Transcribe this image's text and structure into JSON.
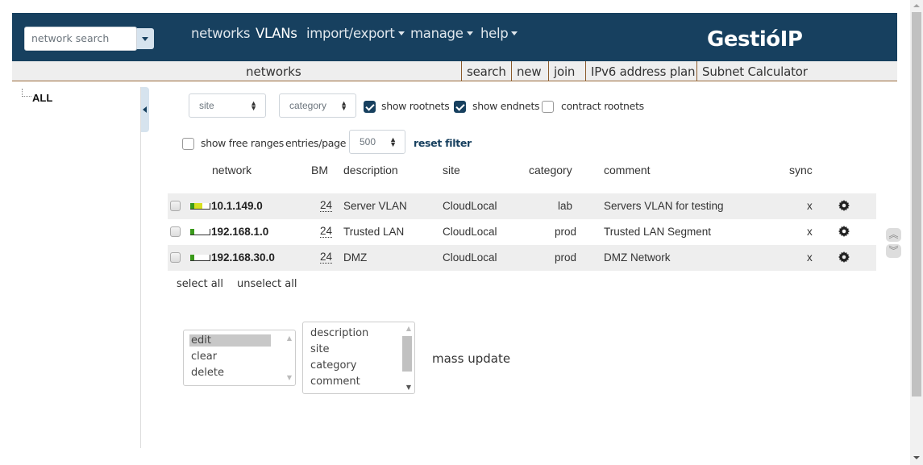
{
  "header": {
    "search_placeholder": "network search",
    "nav": [
      {
        "label": "networks",
        "active": false,
        "dropdown": false
      },
      {
        "label": "VLANs",
        "active": true,
        "dropdown": false
      },
      {
        "label": "import/export",
        "active": false,
        "dropdown": true
      },
      {
        "label": "manage",
        "active": false,
        "dropdown": true
      },
      {
        "label": "help",
        "active": false,
        "dropdown": true
      }
    ],
    "brand": "GestióIP",
    "brand_color": "#17405f"
  },
  "subbar": {
    "title": "networks",
    "links": [
      "search",
      "new",
      "join",
      "IPv6 address plan",
      "Subnet Calculator"
    ]
  },
  "tree": {
    "root": "ALL"
  },
  "filters": {
    "site_select": "site",
    "category_select": "category",
    "show_rootnets": {
      "label": "show rootnets",
      "checked": true
    },
    "show_endnets": {
      "label": "show endnets",
      "checked": true
    },
    "contract_rootnets": {
      "label": "contract rootnets",
      "checked": false
    },
    "show_free_ranges": {
      "label": "show free ranges",
      "checked": false
    },
    "entries_label": "entries/page",
    "entries_value": "500",
    "reset_filter": "reset filter"
  },
  "table": {
    "headers": {
      "network": "network",
      "bm": "BM",
      "description": "description",
      "site": "site",
      "category": "category",
      "comment": "comment",
      "sync": "sync"
    },
    "rows": [
      {
        "network": "10.1.149.0",
        "bm": "24",
        "description": "Server VLAN",
        "site": "CloudLocal",
        "category": "lab",
        "comment": "Servers VLAN for testing",
        "sync": "x",
        "usage_used": 0.2,
        "usage_reserved": 0.4
      },
      {
        "network": "192.168.1.0",
        "bm": "24",
        "description": "Trusted LAN",
        "site": "CloudLocal",
        "category": "prod",
        "comment": "Trusted LAN Segment",
        "sync": "x",
        "usage_used": 0.2,
        "usage_reserved": 0
      },
      {
        "network": "192.168.30.0",
        "bm": "24",
        "description": "DMZ",
        "site": "CloudLocal",
        "category": "prod",
        "comment": "DMZ Network",
        "sync": "x",
        "usage_used": 0.2,
        "usage_reserved": 0
      }
    ]
  },
  "selection": {
    "select_all": "select all",
    "unselect_all": "unselect all"
  },
  "mass_update": {
    "actions": [
      "edit",
      "clear",
      "delete"
    ],
    "selected_action": "edit",
    "fields": [
      "description",
      "site",
      "category",
      "comment"
    ],
    "label": "mass update"
  },
  "jump": {
    "up": "︽",
    "down": "︾"
  }
}
